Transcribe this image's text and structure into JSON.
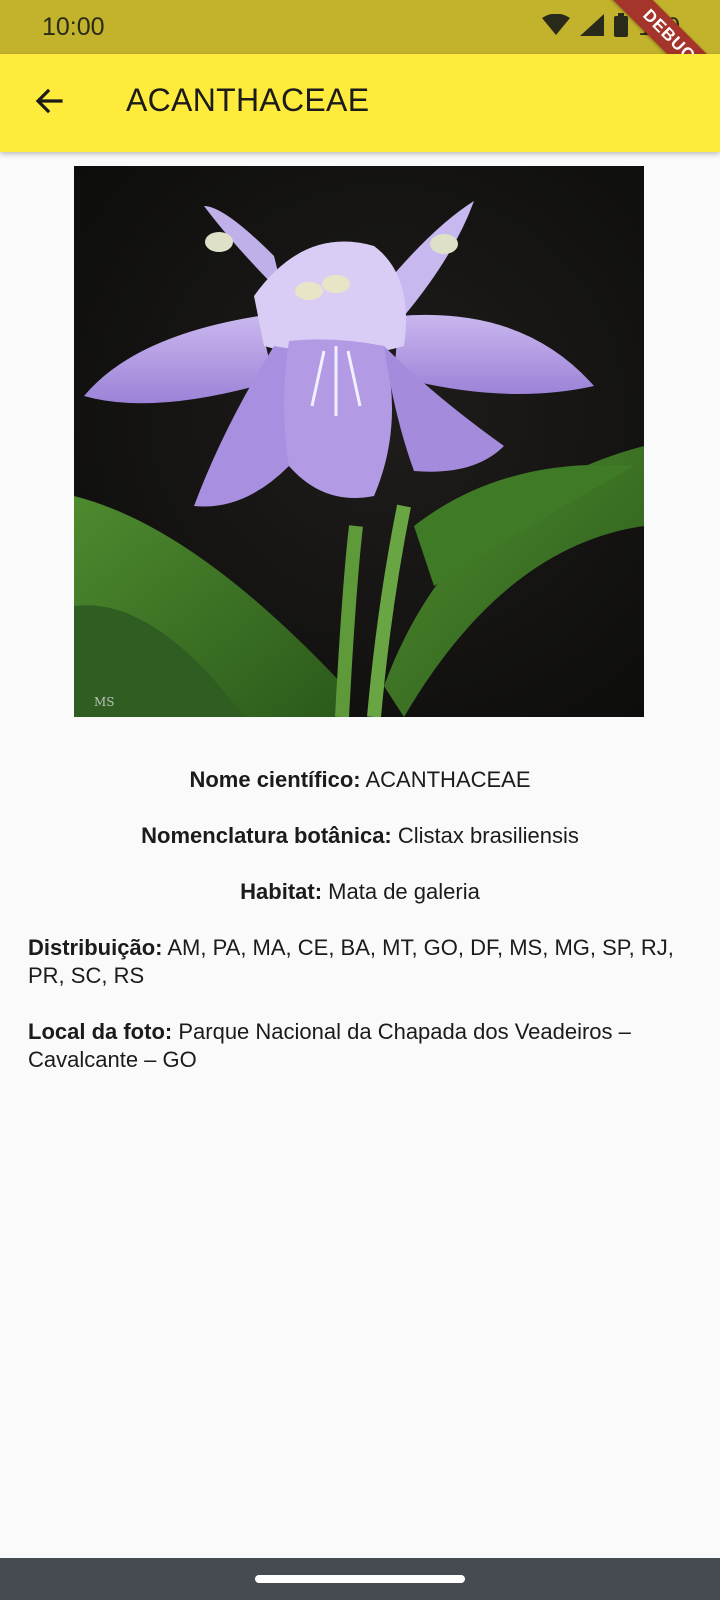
{
  "status_bar": {
    "time": "10:00",
    "battery_text": "100",
    "icons": [
      "wifi-icon",
      "signal-icon",
      "battery-icon"
    ]
  },
  "debug_banner": "DEBUG",
  "app_bar": {
    "back_icon": "arrow-back-icon",
    "title": "ACANTHACEAE"
  },
  "photo": {
    "credit": "MS"
  },
  "details": {
    "scientific_name_label": "Nome científico:",
    "scientific_name_value": "ACANTHACEAE",
    "nomenclature_label": "Nomenclatura botânica:",
    "nomenclature_value": "Clistax brasiliensis",
    "habitat_label": "Habitat:",
    "habitat_value": "Mata de galeria",
    "distribution_label": "Distribuição:",
    "distribution_value": "AM, PA, MA, CE, BA, MT, GO, DF, MS, MG, SP, RJ, PR, SC, RS",
    "photo_location_label": "Local da foto:",
    "photo_location_value": "Parque Nacional da Chapada dos Veadeiros – Cavalcante – GO"
  },
  "colors": {
    "status_bar": "#c3b22c",
    "app_bar": "#ffeb3b",
    "background": "#fafafa",
    "nav_bar": "#454b51",
    "debug_banner": "#a5342a"
  }
}
